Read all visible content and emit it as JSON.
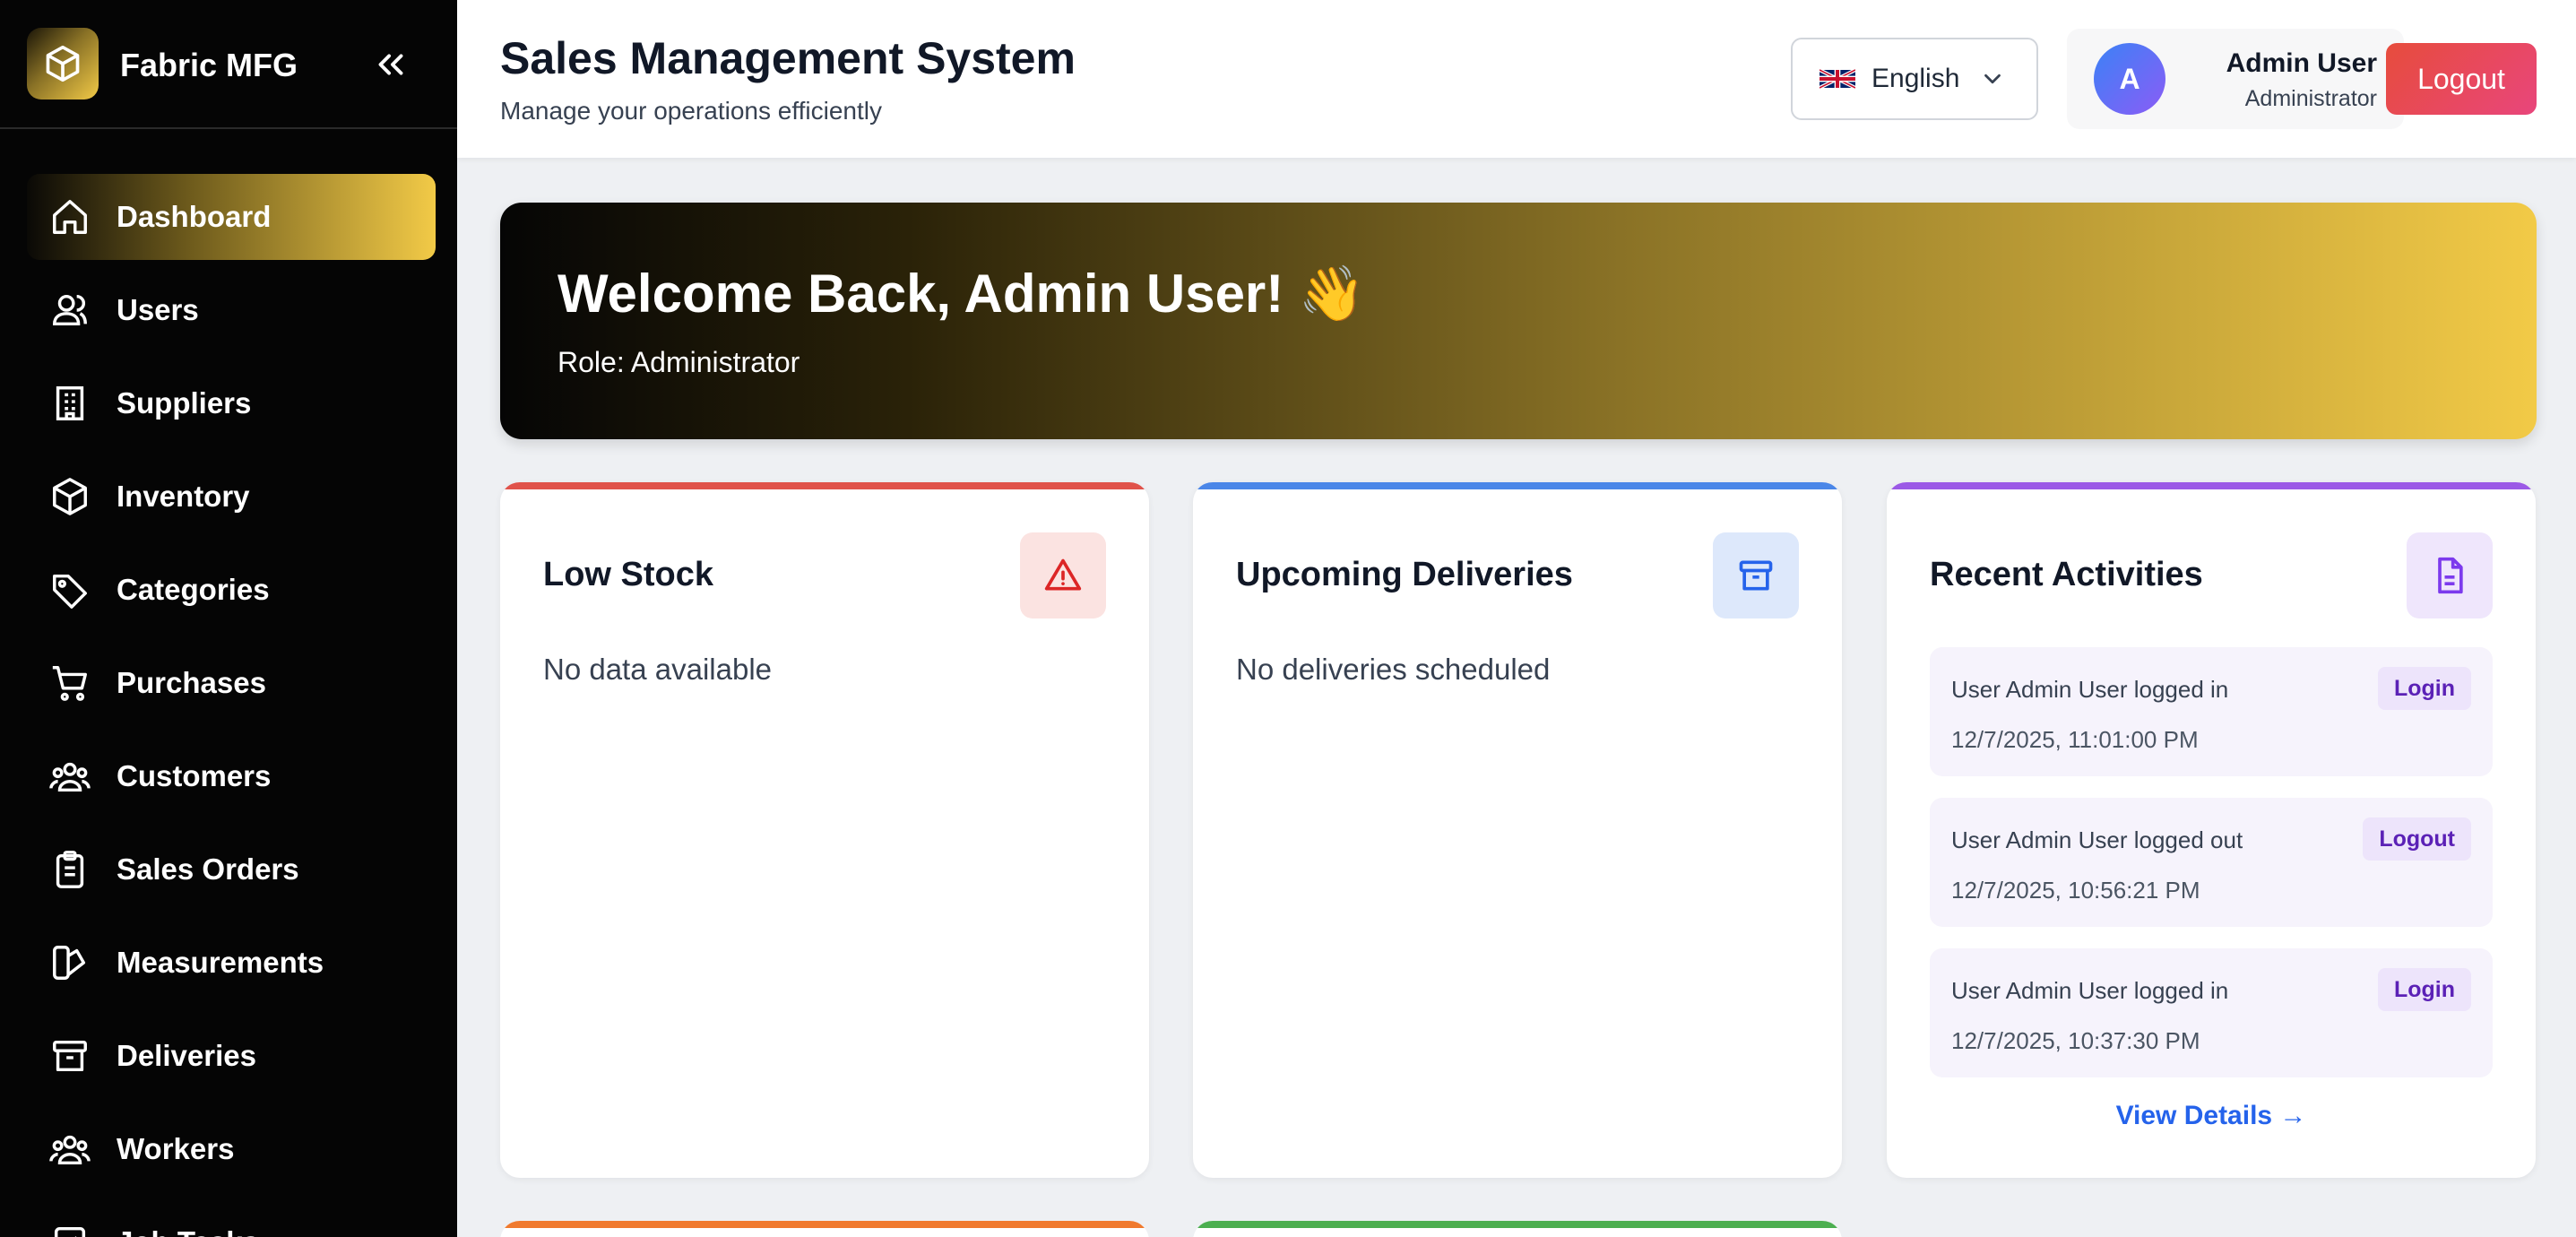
{
  "brand": {
    "name": "Fabric MFG"
  },
  "sidebar": {
    "items": [
      {
        "label": "Dashboard",
        "icon": "home-icon",
        "active": true
      },
      {
        "label": "Users",
        "icon": "users-icon"
      },
      {
        "label": "Suppliers",
        "icon": "building-icon"
      },
      {
        "label": "Inventory",
        "icon": "box-icon"
      },
      {
        "label": "Categories",
        "icon": "tag-icon"
      },
      {
        "label": "Purchases",
        "icon": "cart-icon"
      },
      {
        "label": "Customers",
        "icon": "customers-icon"
      },
      {
        "label": "Sales Orders",
        "icon": "clipboard-icon"
      },
      {
        "label": "Measurements",
        "icon": "swatch-icon"
      },
      {
        "label": "Deliveries",
        "icon": "archive-icon"
      },
      {
        "label": "Workers",
        "icon": "workers-icon"
      },
      {
        "label": "Job Tasks",
        "icon": "tasks-icon"
      }
    ]
  },
  "header": {
    "title": "Sales Management System",
    "subtitle": "Manage your operations efficiently",
    "language": "English",
    "user": {
      "initial": "A",
      "name": "Admin User",
      "role": "Administrator"
    },
    "logout_label": "Logout"
  },
  "welcome": {
    "title": "Welcome Back, Admin User! 👋",
    "role": "Role: Administrator"
  },
  "cards": {
    "low_stock": {
      "title": "Low Stock",
      "empty": "No data available",
      "accent": "#e0524a"
    },
    "deliveries": {
      "title": "Upcoming Deliveries",
      "empty": "No deliveries scheduled",
      "accent": "#4a86e8"
    },
    "activities": {
      "title": "Recent Activities",
      "accent": "#9b59e6",
      "items": [
        {
          "text": "User Admin User logged in",
          "time": "12/7/2025, 11:01:00 PM",
          "badge": "Login"
        },
        {
          "text": "User Admin User logged out",
          "time": "12/7/2025, 10:56:21 PM",
          "badge": "Logout"
        },
        {
          "text": "User Admin User logged in",
          "time": "12/7/2025, 10:37:30 PM",
          "badge": "Login"
        }
      ],
      "view_details": "View Details →"
    }
  },
  "colors": {
    "gold": "#f2ca47",
    "orange": "#f07a2e",
    "green": "#4caf50"
  }
}
